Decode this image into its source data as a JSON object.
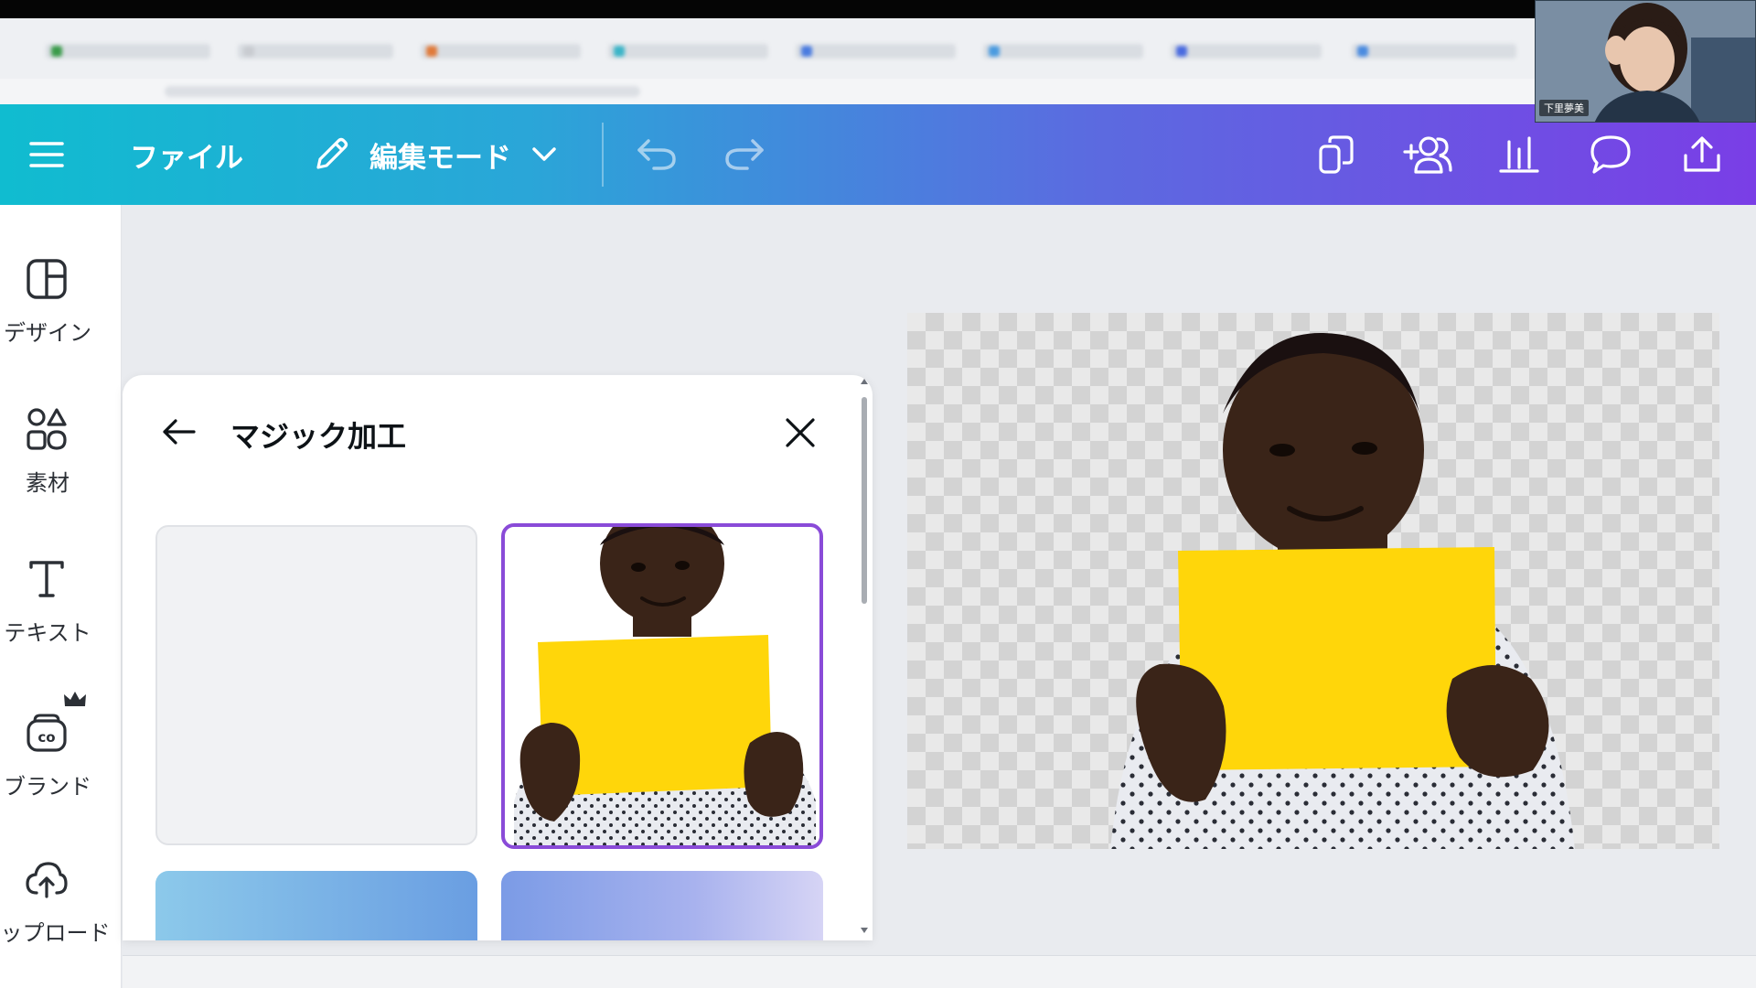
{
  "toolbar": {
    "file_label": "ファイル",
    "mode_label": "編集モード"
  },
  "rail": {
    "items": [
      {
        "label": "デザイン",
        "icon": "layout-icon"
      },
      {
        "label": "素材",
        "icon": "shapes-icon"
      },
      {
        "label": "テキスト",
        "icon": "text-t-icon"
      },
      {
        "label": "ブランド",
        "icon": "brand-crown-icon"
      },
      {
        "label": "ップロード",
        "icon": "cloud-upload-icon"
      }
    ]
  },
  "panel": {
    "title": "マジック加工"
  },
  "webcam": {
    "name": "下里夢美"
  },
  "colors": {
    "toolbar_start": "#10bcd0",
    "toolbar_end": "#7a3ee6",
    "selection_border": "#8a4bd8",
    "paper_yellow": "#ffd60a"
  }
}
